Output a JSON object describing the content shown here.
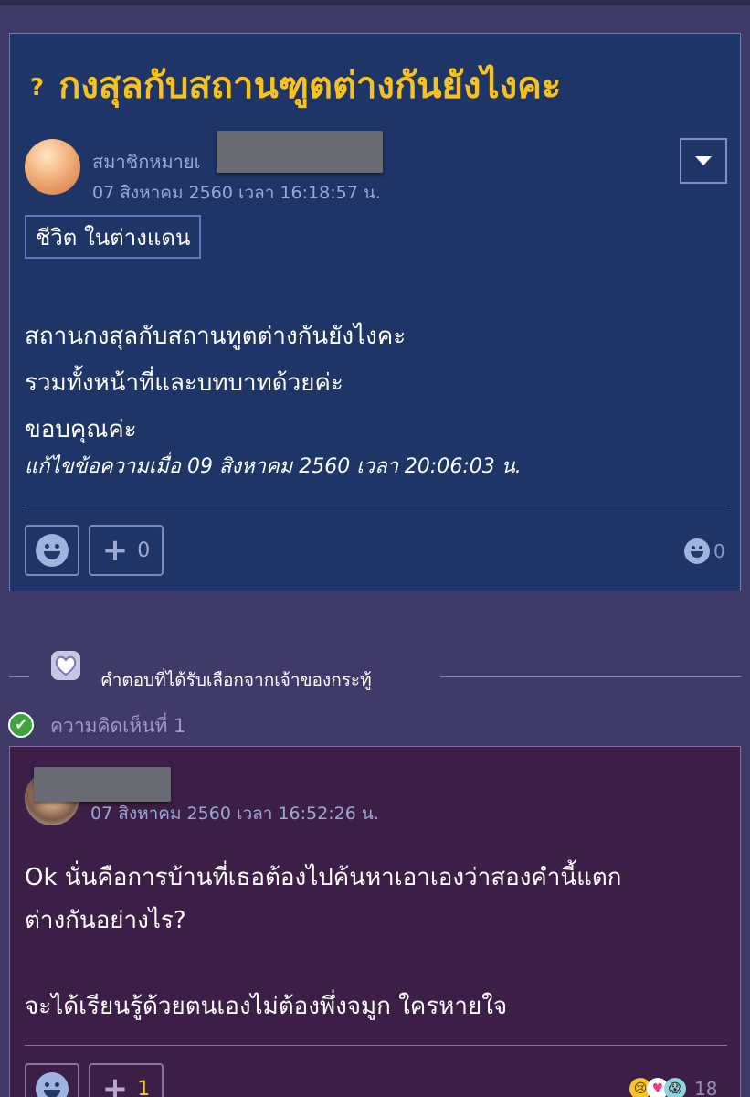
{
  "topic": {
    "title": "กงสุลกับสถานฑูตต่างกันยังไงคะ",
    "question_mark": "?",
    "author_name": "สมาชิกหมายเ",
    "date": "07 สิงหาคม 2560 เวลา 16:18:57 น.",
    "tag": "ชีวิต ในต่างแดน",
    "body_lines": [
      "สถานกงสุลกับสถานทูตต่างกันยังไงคะ",
      "รวมทั้งหน้าที่และบทบาทด้วยค่ะ",
      "ขอบคุณค่ะ"
    ],
    "edited_note": "แก้ไขข้อความเมื่อ 09 สิงหาคม 2560 เวลา 20:06:03 น.",
    "plus_glyph": "+",
    "vote_count": "0",
    "emotion_count": "0"
  },
  "separator": {
    "selected_label": "คำตอบที่ได้รับเลือกจากเจ้าของกระทู้"
  },
  "comment": {
    "number_label": "ความคิดเห็นที่ 1",
    "check_glyph": "✔",
    "date": "07 สิงหาคม 2560 เวลา 16:52:26 น.",
    "body_lines": [
      "Ok นั่นคือการบ้านที่เธอต้องไปค้นหาเอาเองว่าสองคำนี้แตก",
      "ต่างกันอย่างไร?",
      "",
      "จะได้เรียนรู้ด้วยตนเองไม่ต้องพึ่งจมูก ใครหายใจ"
    ],
    "plus_glyph": "+",
    "vote_count": "1",
    "reaction_glyphs": [
      "😢",
      "♥",
      "😱"
    ],
    "reaction_count": "18"
  },
  "colors": {
    "background": "#3f3a68",
    "topic_card": "#1f3567",
    "comment_card": "#3b1f46",
    "title": "#f6c21f",
    "vote_highlight": "#f0d020"
  },
  "icons": {
    "dropdown": "chevron-down-icon",
    "emotion": "smiley-icon",
    "plus": "plus-icon",
    "selected": "heart-badge-icon",
    "check": "check-circle-icon"
  }
}
